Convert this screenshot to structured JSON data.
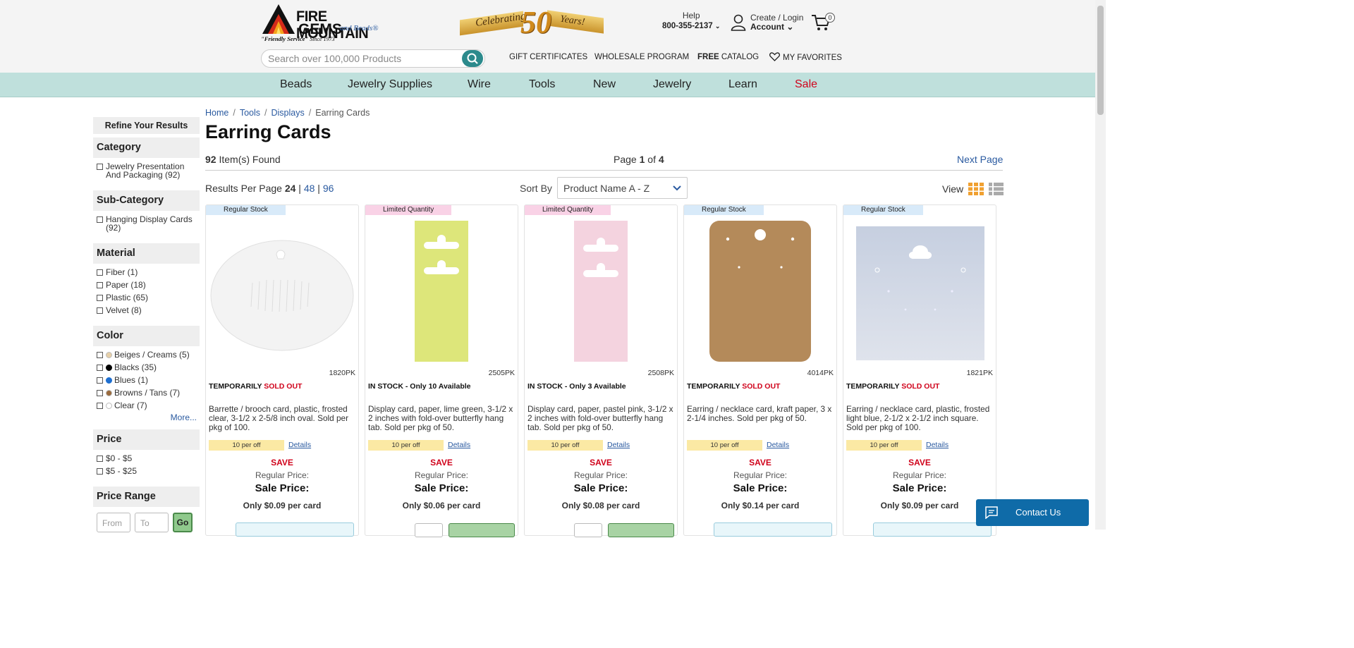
{
  "header": {
    "logo_line1": "FIRE MOUNTAIN",
    "logo_line2": "GEMS",
    "logo_beads": "and Beads®",
    "logo_tag_bold": "\"Friendly Service\"",
    "logo_tag_since": " Since 1973",
    "banner_celebrating": "Celebrating",
    "banner_number": "50",
    "banner_years": "Years!",
    "help_label": "Help",
    "help_phone": "800-355-2137",
    "account_line1": "Create / Login",
    "account_line2": "Account",
    "cart_count": "0",
    "search_placeholder": "Search over 100,000 Products",
    "links": {
      "gift": "GIFT CERTIFICATES",
      "wholesale": "WHOLESALE PROGRAM",
      "catalog_bold": "FREE",
      "catalog_rest": " CATALOG",
      "favorites": "MY FAVORITES"
    }
  },
  "nav": {
    "items": [
      "Beads",
      "Jewelry Supplies",
      "Wire",
      "Tools",
      "New",
      "Jewelry",
      "Learn",
      "Sale"
    ]
  },
  "sidebar": {
    "refine": "Refine Your Results",
    "category": {
      "title": "Category",
      "options": [
        "Jewelry Presentation And Packaging (92)"
      ]
    },
    "subcategory": {
      "title": "Sub-Category",
      "options": [
        "Hanging Display Cards (92)"
      ]
    },
    "material": {
      "title": "Material",
      "options": [
        "Fiber (1)",
        "Paper (18)",
        "Plastic (65)",
        "Velvet (8)"
      ]
    },
    "color": {
      "title": "Color",
      "options": [
        {
          "label": "Beiges / Creams (5)",
          "swatch": "#e6cfa8"
        },
        {
          "label": "Blacks (35)",
          "swatch": "#000000"
        },
        {
          "label": "Blues (1)",
          "swatch": "#1e6fd0"
        },
        {
          "label": "Browns / Tans (7)",
          "swatch": "#9a6a3c"
        },
        {
          "label": "Clear (7)",
          "swatch": "#ffffff"
        }
      ],
      "more": "More..."
    },
    "price": {
      "title": "Price",
      "options": [
        "$0 - $5",
        "$5 - $25"
      ]
    },
    "price_range": {
      "title": "Price Range",
      "from": "From",
      "to": "To",
      "go": "Go"
    }
  },
  "main": {
    "breadcrumb": [
      "Home",
      "Tools",
      "Displays",
      "Earring Cards"
    ],
    "title": "Earring Cards",
    "found_count": "92",
    "found_label": " Item(s) Found",
    "page_prefix": "Page ",
    "page_current": "1",
    "page_of": " of ",
    "page_total": "4",
    "next_page": "Next Page",
    "rpp_label": "Results Per Page ",
    "rpp_current": "24",
    "rpp_opt1": "48",
    "rpp_opt2": "96",
    "sort_label": "Sort By",
    "sort_value": "Product Name A - Z",
    "view_label": "View"
  },
  "products": [
    {
      "stock": "Regular Stock",
      "sku": "1820PK",
      "avail_prefix": "TEMPORARILY ",
      "avail_red": "SOLD OUT",
      "desc": "Barrette / brooch card, plastic, frosted clear, 3-1/2 x 2-5/8 inch oval. Sold per pkg of 100.",
      "promo": "10 per off",
      "details": "Details",
      "save": "SAVE",
      "regular": "Regular Price:",
      "sale": "Sale Price:",
      "per": "Only $0.09 per card"
    },
    {
      "stock": "Limited Quantity",
      "sku": "2505PK",
      "avail_prefix": "IN STOCK - Only 10 Available",
      "avail_red": "",
      "desc": "Display card, paper, lime green, 3-1/2 x 2 inches with fold-over butterfly hang tab. Sold per pkg of 50.",
      "promo": "10 per off",
      "details": "Details",
      "save": "SAVE",
      "regular": "Regular Price:",
      "sale": "Sale Price:",
      "per": "Only $0.06 per card"
    },
    {
      "stock": "Limited Quantity",
      "sku": "2508PK",
      "avail_prefix": "IN STOCK - Only 3 Available",
      "avail_red": "",
      "desc": "Display card, paper, pastel pink, 3-1/2 x 2 inches with fold-over butterfly hang tab. Sold per pkg of 50.",
      "promo": "10 per off",
      "details": "Details",
      "save": "SAVE",
      "regular": "Regular Price:",
      "sale": "Sale Price:",
      "per": "Only $0.08 per card"
    },
    {
      "stock": "Regular Stock",
      "sku": "4014PK",
      "avail_prefix": "TEMPORARILY ",
      "avail_red": "SOLD OUT",
      "desc": "Earring / necklace card, kraft paper, 3 x 2-1/4 inches. Sold per pkg of 50.",
      "promo": "10 per off",
      "details": "Details",
      "save": "SAVE",
      "regular": "Regular Price:",
      "sale": "Sale Price:",
      "per": "Only $0.14 per card"
    },
    {
      "stock": "Regular Stock",
      "sku": "1821PK",
      "avail_prefix": "TEMPORARILY ",
      "avail_red": "SOLD OUT",
      "desc": "Earring / necklace card, plastic, frosted light blue, 2-1/2 x 2-1/2 inch square. Sold per pkg of 100.",
      "promo": "10 per off",
      "details": "Details",
      "save": "SAVE",
      "regular": "Regular Price:",
      "sale": "Sale Price:",
      "per": "Only $0.09 per card"
    }
  ],
  "contact": {
    "label": "Contact Us"
  },
  "colors": {
    "teal_nav": "#bfe0dc",
    "sale_red": "#d0021b",
    "link_blue": "#2a5aa0",
    "contact_blue": "#0f6ba8"
  }
}
